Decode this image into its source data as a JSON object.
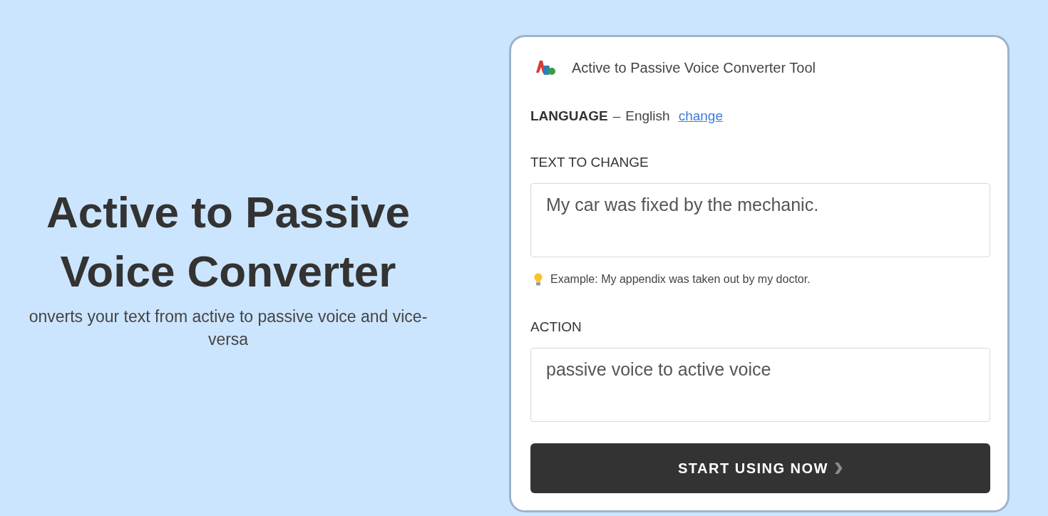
{
  "hero": {
    "title": "Active to Passive Voice Converter",
    "subtitle": "onverts your text from active to passive voice and vice-versa"
  },
  "tool": {
    "title": "Active to Passive Voice Converter Tool",
    "language": {
      "label": "LANGUAGE",
      "separator": "–",
      "value": "English",
      "link": "change"
    },
    "fields": [
      {
        "label": "TEXT TO CHANGE",
        "value": "My car was fixed by the mechanic.",
        "hint": "Example: My appendix was taken out by my doctor."
      },
      {
        "label": "ACTION",
        "value": "passive voice to active voice"
      }
    ],
    "button": {
      "label": "START USING NOW"
    }
  }
}
